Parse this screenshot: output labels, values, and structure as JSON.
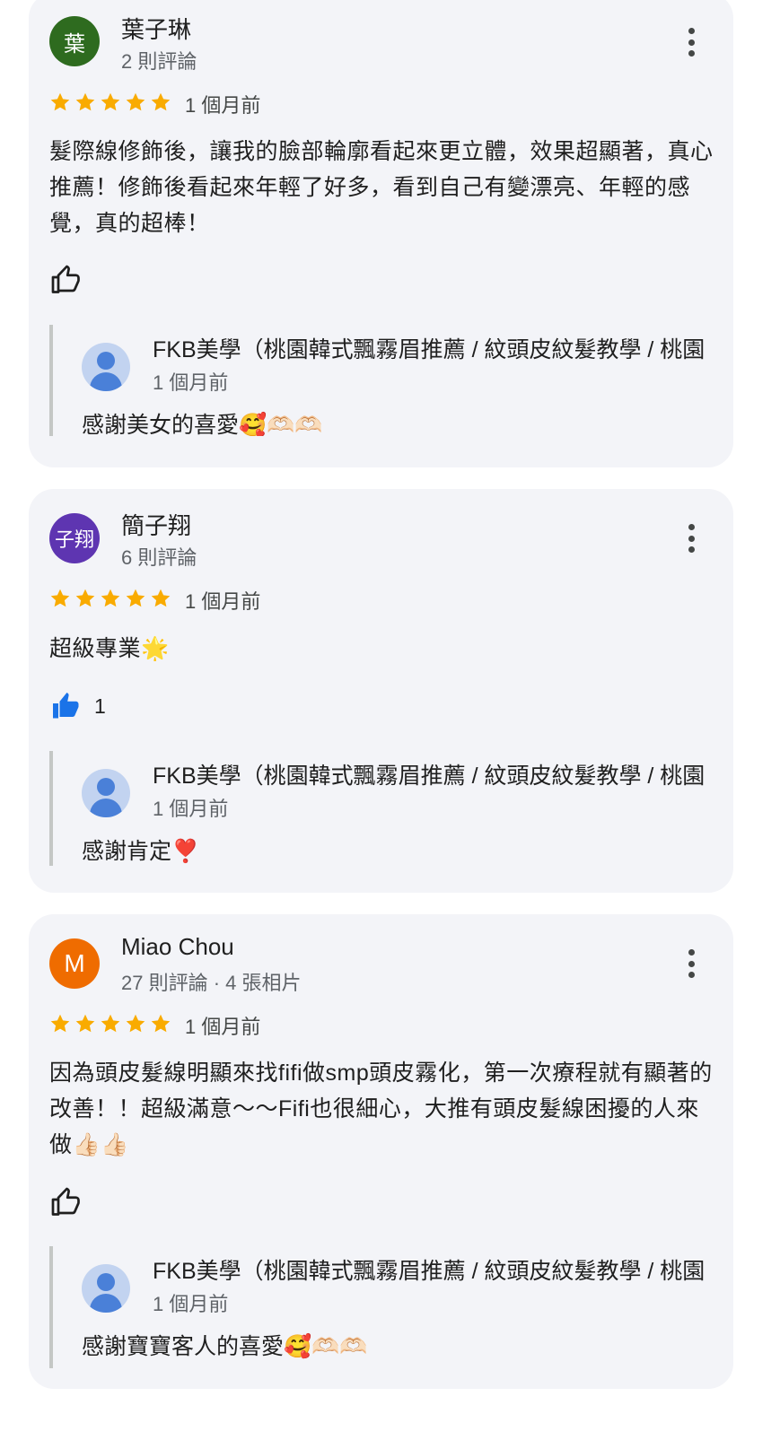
{
  "reviews": [
    {
      "avatar_letter": "葉",
      "avatar_color": "#2e6b1f",
      "name": "葉子琳",
      "meta": "2 則評論",
      "rating": 5,
      "time": "1 個月前",
      "text": "髮際線修飾後，讓我的臉部輪廓看起來更立體，效果超顯著，真心推薦！修飾後看起來年輕了好多，看到自己有變漂亮、年輕的感覺，真的超棒！",
      "like_count": "",
      "liked": false,
      "reply": {
        "owner": "FKB美學（桃園韓式飄霧眉推薦 / 紋頭皮紋髮教學 / 桃園",
        "time": "1 個月前",
        "text": "感謝美女的喜愛🥰🫶🏻🫶🏻"
      }
    },
    {
      "avatar_letter": "子翔",
      "avatar_color": "#5e35b1",
      "name": "簡子翔",
      "meta": "6 則評論",
      "rating": 5,
      "time": "1 個月前",
      "text": "超級專業🌟",
      "like_count": "1",
      "liked": true,
      "reply": {
        "owner": "FKB美學（桃園韓式飄霧眉推薦 / 紋頭皮紋髮教學 / 桃園",
        "time": "1 個月前",
        "text": "感謝肯定❣️"
      }
    },
    {
      "avatar_letter": "M",
      "avatar_color": "#ef6c00",
      "name": "Miao Chou",
      "meta": "27 則評論 · 4 張相片",
      "rating": 5,
      "time": "1 個月前",
      "text": "因為頭皮髮線明顯來找fifi做smp頭皮霧化，第一次療程就有顯著的改善！！超級滿意～～Fifi也很細心，大推有頭皮髮線困擾的人來做👍🏻👍🏻",
      "like_count": "",
      "liked": false,
      "reply": {
        "owner": "FKB美學（桃園韓式飄霧眉推薦 / 紋頭皮紋髮教學 / 桃園",
        "time": "1 個月前",
        "text": "感謝寶寶客人的喜愛🥰🫶🏻🫶🏻"
      }
    }
  ],
  "colors": {
    "star": "#f9ab00",
    "liked": "#1a73e8"
  }
}
